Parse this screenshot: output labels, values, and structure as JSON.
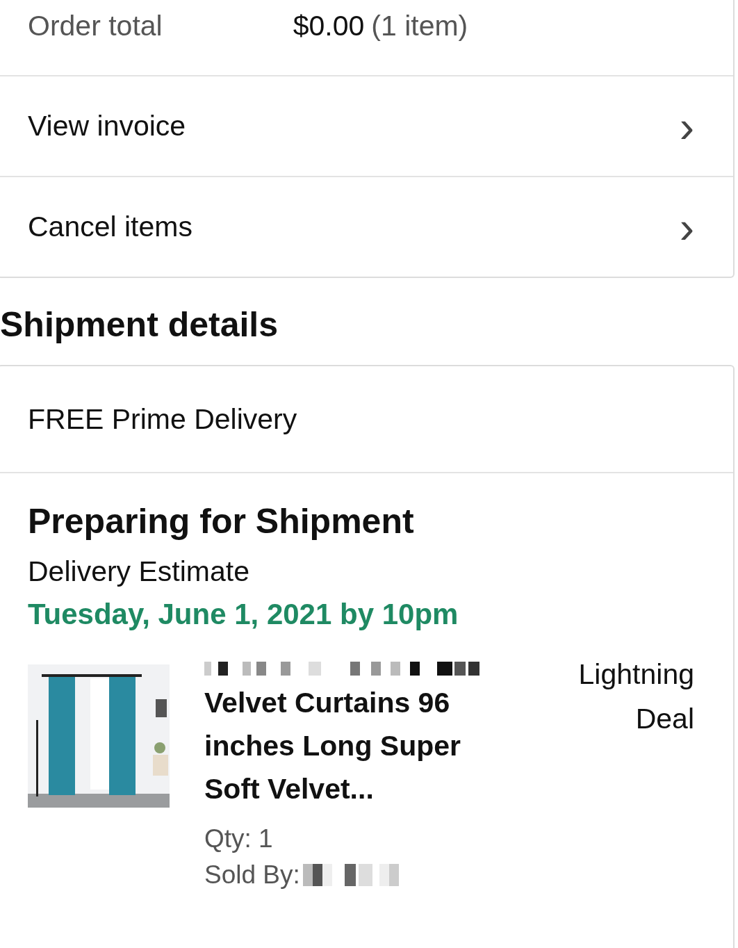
{
  "order_summary": {
    "total_label": "Order total",
    "total_amount": "$0.00",
    "total_count": "(1 item)"
  },
  "links": [
    {
      "label": "View invoice",
      "chevron": "›"
    },
    {
      "label": "Cancel items",
      "chevron": "›"
    }
  ],
  "shipment_heading": "Shipment details",
  "shipment": {
    "delivery_type": "FREE Prime Delivery",
    "status": "Preparing for Shipment",
    "estimate_label": "Delivery Estimate",
    "estimate_date": "Tuesday, June 1, 2021 by 10pm",
    "item": {
      "title": "Velvet Curtains 96 inches Long Super Soft Velvet...",
      "qty": "Qty: 1",
      "sold_by": "Sold By:",
      "deal": "Lightning Deal"
    }
  }
}
